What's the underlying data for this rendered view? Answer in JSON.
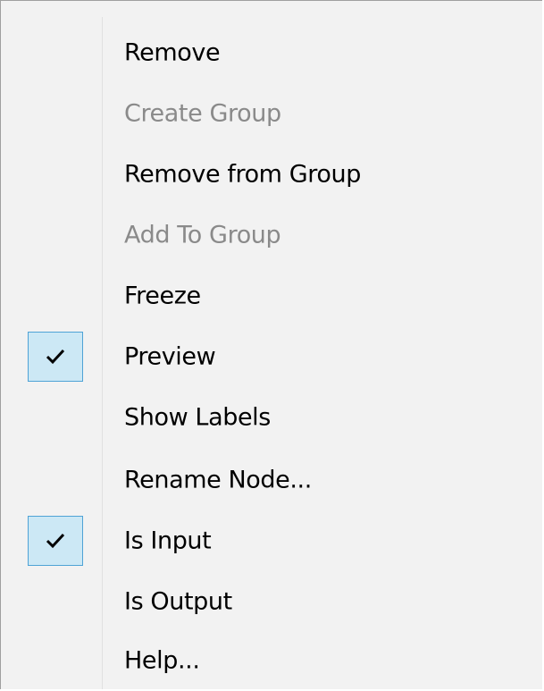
{
  "menu": {
    "items": [
      {
        "label": "Remove",
        "enabled": true,
        "checked": false
      },
      {
        "label": "Create Group",
        "enabled": false,
        "checked": false
      },
      {
        "label": "Remove from Group",
        "enabled": true,
        "checked": false
      },
      {
        "label": "Add To Group",
        "enabled": false,
        "checked": false
      },
      {
        "label": "Freeze",
        "enabled": true,
        "checked": false
      },
      {
        "label": "Preview",
        "enabled": true,
        "checked": true
      },
      {
        "label": "Show Labels",
        "enabled": true,
        "checked": false
      },
      {
        "label": "Rename Node...",
        "enabled": true,
        "checked": false
      },
      {
        "label": "Is Input",
        "enabled": true,
        "checked": true
      },
      {
        "label": "Is Output",
        "enabled": true,
        "checked": false
      },
      {
        "label": "Help...",
        "enabled": true,
        "checked": false
      }
    ]
  },
  "colors": {
    "menu_background": "#f2f2f2",
    "disabled_text": "#8a8a8a",
    "check_highlight": "#cce8f5",
    "check_border": "#4fa3d6"
  },
  "icons": {
    "check": "check-icon"
  }
}
